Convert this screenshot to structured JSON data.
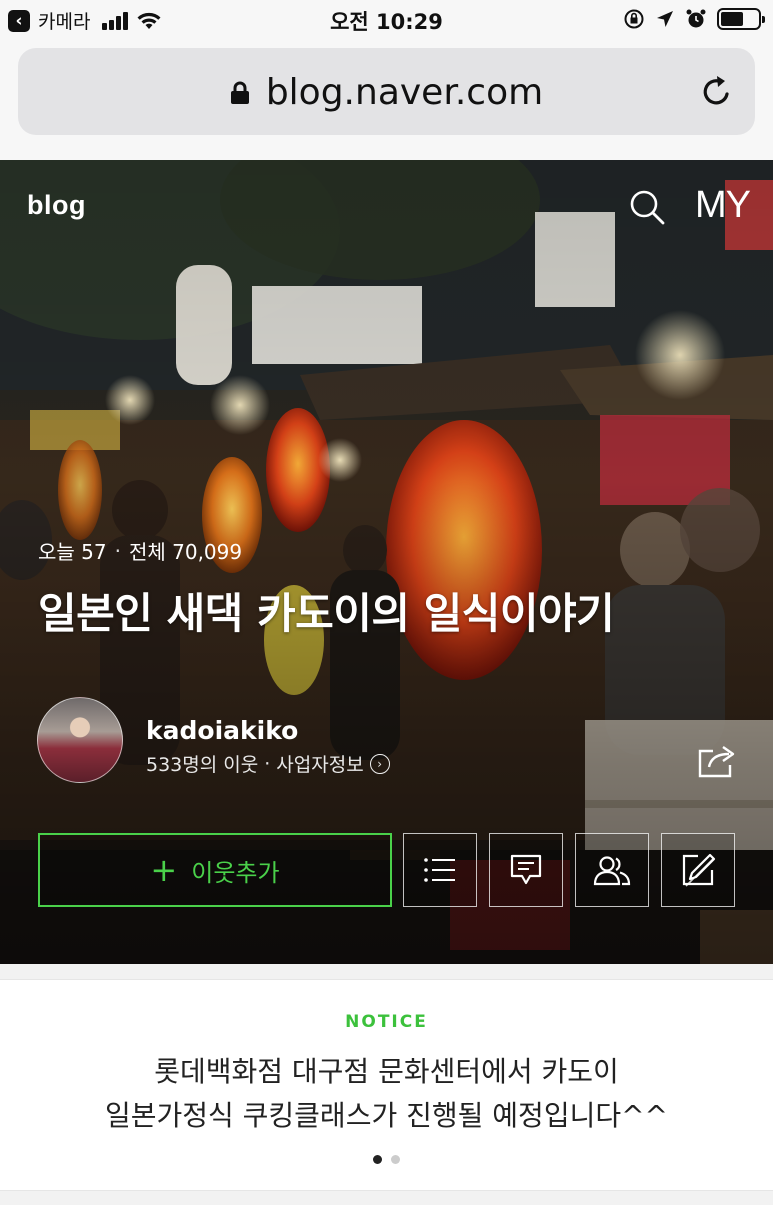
{
  "status_bar": {
    "back_app": "카메라",
    "time": "오전 10:29",
    "signal_bars": 4,
    "battery_level": 0.6
  },
  "url_bar": {
    "url": "blog.naver.com",
    "lock_icon": "lock-icon",
    "reload_icon": "reload-icon"
  },
  "hero": {
    "logo": "blog",
    "my_label": "MY",
    "visits_today": "오늘 57",
    "visits_total": "전체 70,099",
    "title": "일본인 새댁 카도이의 일식이야기",
    "username": "kadoiakiko",
    "neighbors": "533명의 이웃",
    "business_info": "사업자정보",
    "add_neighbor_label": "이웃추가",
    "add_neighbor_color": "#4ad14a"
  },
  "notice": {
    "label": "NOTICE",
    "line1": "롯데백화점 대구점 문화센터에서 카도이",
    "line2": "일본가정식 쿠킹클래스가 진행될 예정입니다^^",
    "page_count": 2,
    "active_page": 1,
    "accent_color": "#3cc13c"
  }
}
